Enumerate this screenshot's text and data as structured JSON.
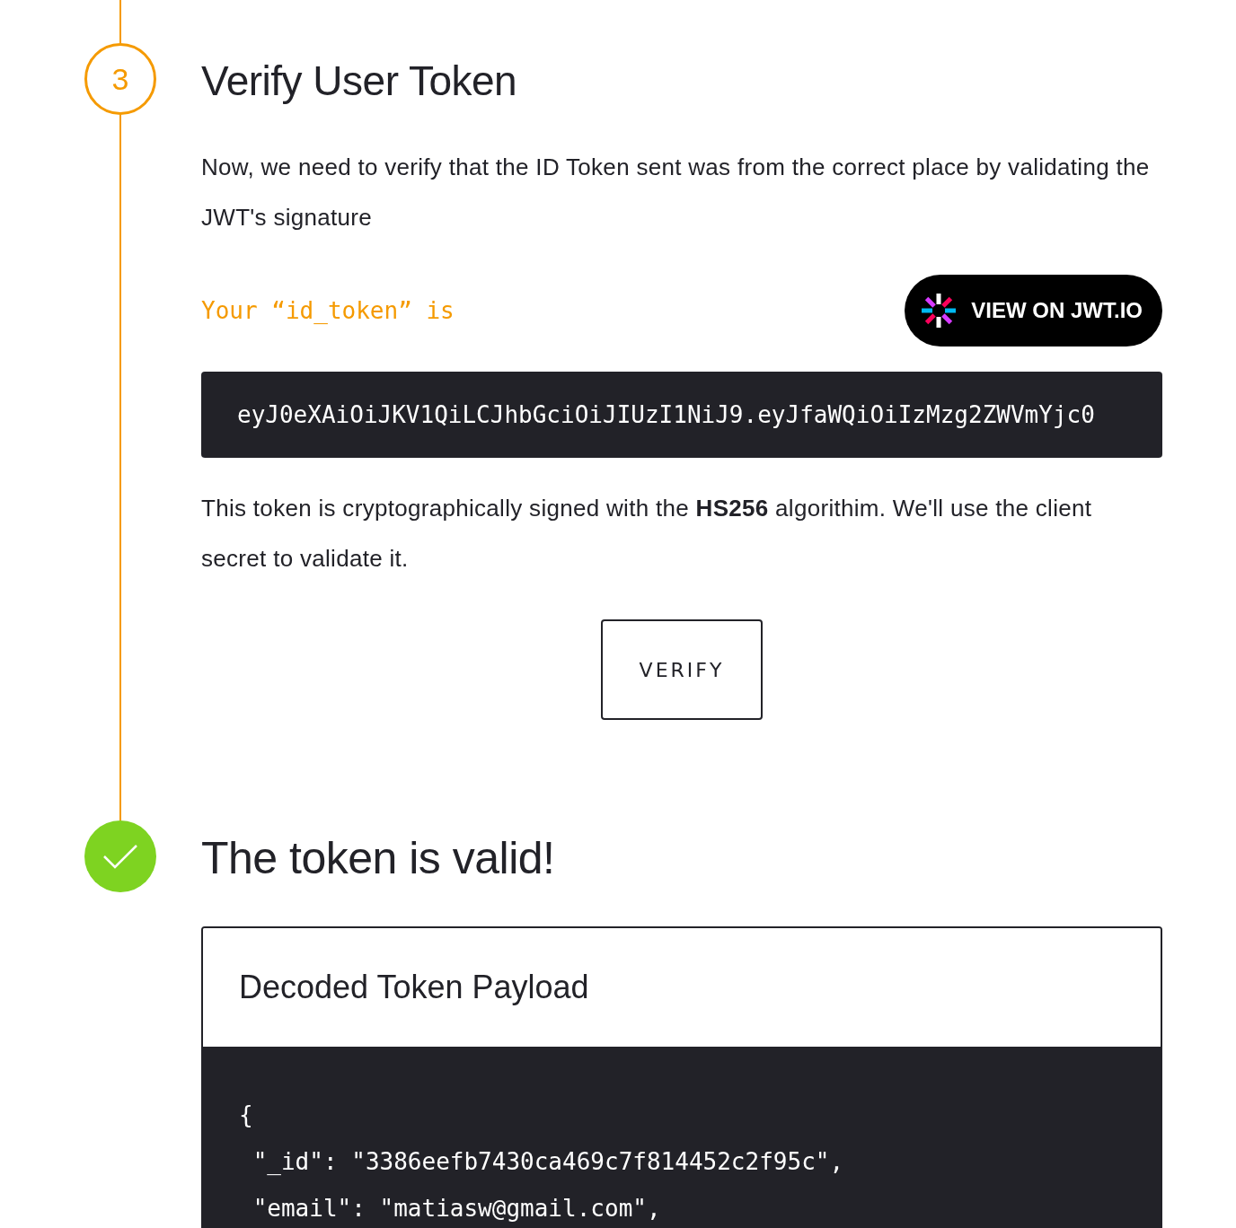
{
  "steps": [
    {
      "kind": "number",
      "marker": "3",
      "title": "Verify User Token",
      "paragraph": "Now, we need to verify that the ID Token sent was from the correct place by validating the JWT's signature",
      "token_label": "Your “id_token” is",
      "jwt_button": "VIEW ON JWT.IO",
      "token": "eyJ0eXAiOiJKV1QiLCJhbGciOiJIUzI1NiJ9.eyJfaWQiOiIzMzg2ZWVmYjc0",
      "note": "This token is cryptographically signed with the **HS256** algorithim. We'll use the client secret to validate it.",
      "button": "VERIFY"
    },
    {
      "kind": "done",
      "title": "The token is valid!",
      "card": {
        "title": "Decoded Token Payload",
        "lines": [
          "{",
          " \"_id\": \"3386eefb7430ca469c7f814452c2f95c\",",
          " \"email\": \"matiasw@gmail.com\","
        ]
      }
    }
  ]
}
